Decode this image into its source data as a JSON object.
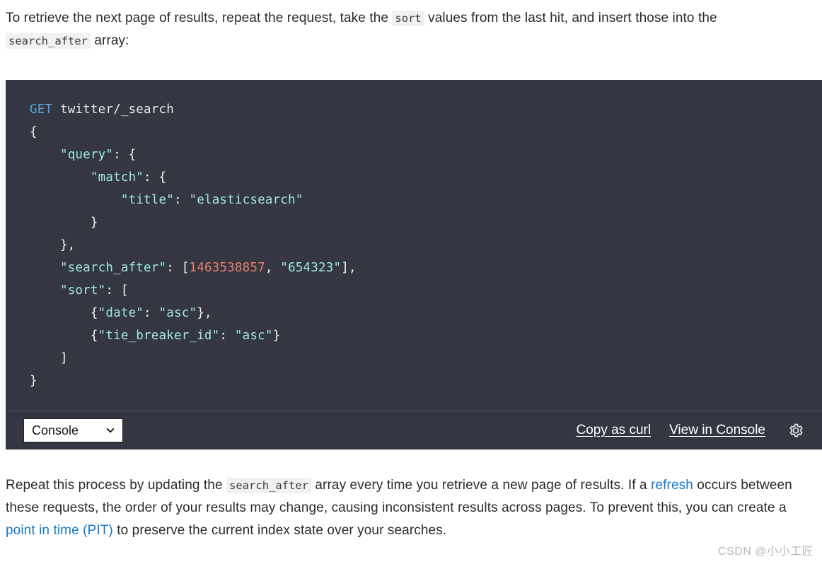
{
  "intro_paragraph": {
    "part1": "To retrieve the next page of results, repeat the request, take the ",
    "code1": "sort",
    "part2": " values from the last hit, and insert those into the ",
    "code2": "search_after",
    "part3": " array:"
  },
  "code_block": {
    "language_label": "Console",
    "lines": [
      {
        "tokens": [
          {
            "t": "GET ",
            "c": "tok-method"
          },
          {
            "t": "twitter/_search",
            "c": "tok-path"
          }
        ]
      },
      {
        "tokens": [
          {
            "t": "{",
            "c": "tok-punct"
          }
        ]
      },
      {
        "tokens": [
          {
            "t": "    ",
            "c": "tok-punct"
          },
          {
            "t": "\"query\"",
            "c": "tok-key"
          },
          {
            "t": ": {",
            "c": "tok-punct"
          }
        ]
      },
      {
        "tokens": [
          {
            "t": "        ",
            "c": "tok-punct"
          },
          {
            "t": "\"match\"",
            "c": "tok-key"
          },
          {
            "t": ": {",
            "c": "tok-punct"
          }
        ]
      },
      {
        "tokens": [
          {
            "t": "            ",
            "c": "tok-punct"
          },
          {
            "t": "\"title\"",
            "c": "tok-key"
          },
          {
            "t": ": ",
            "c": "tok-punct"
          },
          {
            "t": "\"elasticsearch\"",
            "c": "tok-string"
          }
        ]
      },
      {
        "tokens": [
          {
            "t": "        }",
            "c": "tok-punct"
          }
        ]
      },
      {
        "tokens": [
          {
            "t": "    },",
            "c": "tok-punct"
          }
        ]
      },
      {
        "tokens": [
          {
            "t": "    ",
            "c": "tok-punct"
          },
          {
            "t": "\"search_after\"",
            "c": "tok-key"
          },
          {
            "t": ": [",
            "c": "tok-punct"
          },
          {
            "t": "1463538857",
            "c": "tok-number"
          },
          {
            "t": ", ",
            "c": "tok-punct"
          },
          {
            "t": "\"654323\"",
            "c": "tok-string"
          },
          {
            "t": "],",
            "c": "tok-punct"
          }
        ]
      },
      {
        "tokens": [
          {
            "t": "    ",
            "c": "tok-punct"
          },
          {
            "t": "\"sort\"",
            "c": "tok-key"
          },
          {
            "t": ": [",
            "c": "tok-punct"
          }
        ]
      },
      {
        "tokens": [
          {
            "t": "        {",
            "c": "tok-punct"
          },
          {
            "t": "\"date\"",
            "c": "tok-key"
          },
          {
            "t": ": ",
            "c": "tok-punct"
          },
          {
            "t": "\"asc\"",
            "c": "tok-string"
          },
          {
            "t": "},",
            "c": "tok-punct"
          }
        ]
      },
      {
        "tokens": [
          {
            "t": "        {",
            "c": "tok-punct"
          },
          {
            "t": "\"tie_breaker_id\"",
            "c": "tok-key"
          },
          {
            "t": ": ",
            "c": "tok-punct"
          },
          {
            "t": "\"asc\"",
            "c": "tok-string"
          },
          {
            "t": "}",
            "c": "tok-punct"
          }
        ]
      },
      {
        "tokens": [
          {
            "t": "    ]",
            "c": "tok-punct"
          }
        ]
      },
      {
        "tokens": [
          {
            "t": "}",
            "c": "tok-punct"
          }
        ]
      }
    ],
    "toolbar": {
      "copy_as_curl_label": "Copy as curl",
      "view_in_console_label": "View in Console",
      "settings_icon": "gear-icon",
      "dropdown_icon": "chevron-down-icon"
    }
  },
  "outro_paragraph": {
    "part1": "Repeat this process by updating the ",
    "code1": "search_after",
    "part2": " array every time you retrieve a new page of results. If a ",
    "link1": "refresh",
    "part3": " occurs between these requests, the order of your results may change, causing inconsistent results across pages. To prevent this, you can create a ",
    "link2": "point in time (PIT)",
    "part4": " to preserve the current index state over your searches."
  },
  "watermark": "CSDN @小小工匠",
  "colors": {
    "code_background": "#343741",
    "link_blue": "#1878c8",
    "method_blue": "#59a5e0",
    "key_cyan": "#9fe5e8",
    "number_salmon": "#ec8070",
    "inline_code_bg": "#f1f1f1"
  }
}
